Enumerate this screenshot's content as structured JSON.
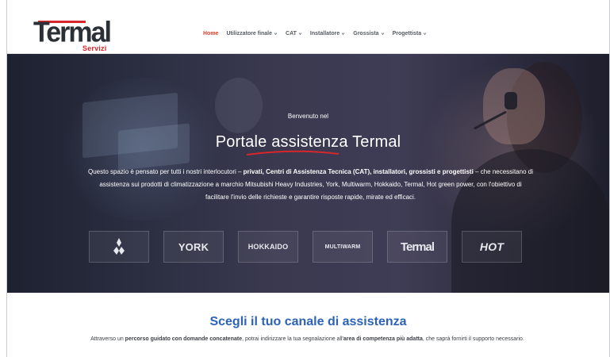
{
  "header": {
    "logo_text": "Termal",
    "logo_subtext": "Servizi",
    "nav": [
      {
        "label": "Home",
        "active": true,
        "has_dropdown": false
      },
      {
        "label": "Utilizzatore finale",
        "active": false,
        "has_dropdown": true
      },
      {
        "label": "CAT",
        "active": false,
        "has_dropdown": true
      },
      {
        "label": "Installatore",
        "active": false,
        "has_dropdown": true
      },
      {
        "label": "Grossista",
        "active": false,
        "has_dropdown": true
      },
      {
        "label": "Progettista",
        "active": false,
        "has_dropdown": true
      }
    ],
    "accent_color": "#e0412f"
  },
  "hero": {
    "welcome": "Benvenuto nel",
    "title": "Portale assistenza Termal",
    "text_part1": "Questo spazio è pensato per tutti i nostri interlocutori – ",
    "text_bold1": "privati, Centri di Assistenza Tecnica (CAT), installatori, grossisti e progettisti",
    "text_part2": " – che necessitano di assistenza sui prodotti di climatizzazione a marchio Mitsubishi Heavy Industries, York, Multiwarm, Hokkaido, Termal, Hot green power, con l'obiettivo di facilitare l'invio delle richieste e garantire risposte rapide, mirate ed efficaci.",
    "underline_color": "#d7262c",
    "brands": [
      {
        "name": "mitsubishi-heavy-industries",
        "text": "MITSUBISHI"
      },
      {
        "name": "york",
        "text": "YORK"
      },
      {
        "name": "hokkaido",
        "text": "HOKKAIDO"
      },
      {
        "name": "multiwarm",
        "text": "MULTIWARM"
      },
      {
        "name": "termal",
        "text": "Termal"
      },
      {
        "name": "hot-green-power",
        "text": "HOT"
      }
    ]
  },
  "section": {
    "title": "Scegli il tuo canale di assistenza",
    "text_part1": "Attraverso un ",
    "text_bold1": "percorso guidato con domande concatenate",
    "text_part2": ", potrai indirizzare la tua segnalazione all'",
    "text_bold2": "area di competenza più adatta",
    "text_part3": ", che saprà fornirti il supporto necessario.",
    "title_color": "#2c63b9"
  }
}
